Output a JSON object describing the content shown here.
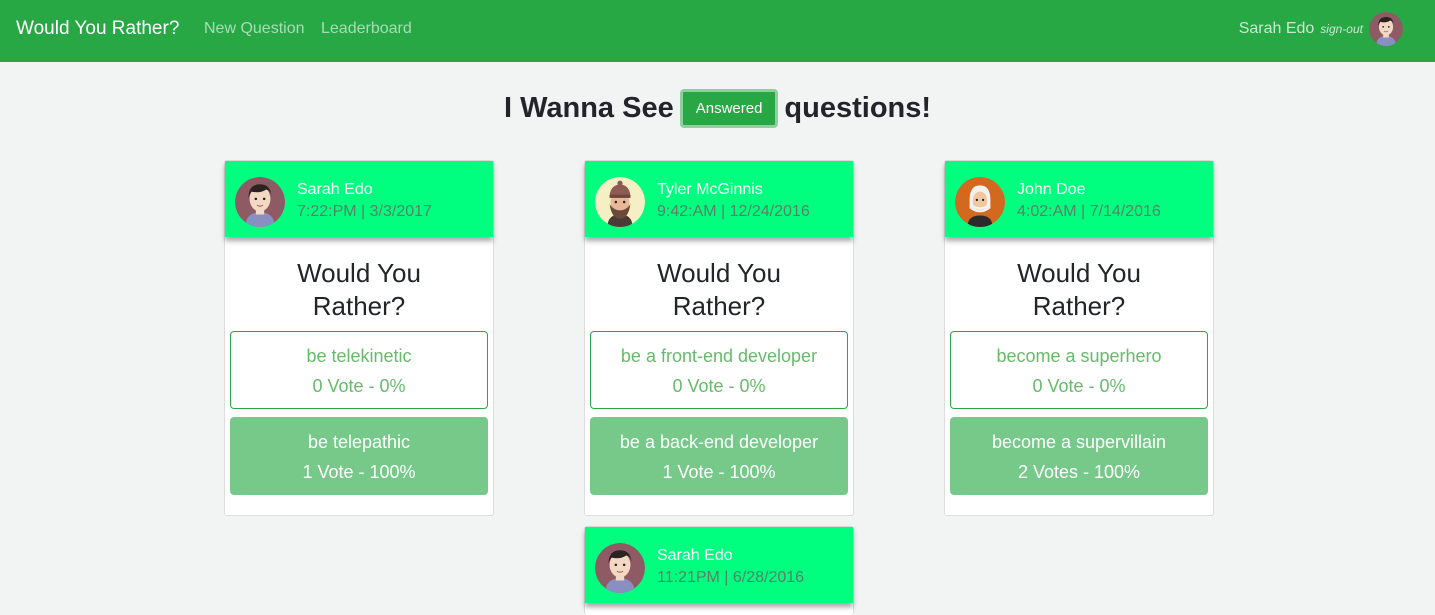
{
  "nav": {
    "brand": "Would You Rather?",
    "links": [
      "New Question",
      "Leaderboard"
    ],
    "user_name": "Sarah Edo",
    "signout": "sign-out"
  },
  "heading": {
    "prefix": "I Wanna See",
    "filter_button": "Answered",
    "suffix": "questions!"
  },
  "colors": {
    "navbar": "#28a745",
    "card_header": "#00ff7f",
    "option_selected": "#77c98a",
    "option_text": "#66bb6a"
  },
  "questions": [
    {
      "author": "Sarah Edo",
      "avatar": "sarah-avatar-icon",
      "time": "7:22:PM | 3/3/2017",
      "title": "Would You Rather?",
      "optionOne": {
        "text": "be telekinetic",
        "votes": "0 Vote - 0%"
      },
      "optionTwo": {
        "text": "be telepathic",
        "votes": "1 Vote - 100%"
      }
    },
    {
      "author": "Tyler McGinnis",
      "avatar": "tyler-avatar-icon",
      "time": "9:42:AM | 12/24/2016",
      "title": "Would You Rather?",
      "optionOne": {
        "text": "be a front-end developer",
        "votes": "0 Vote - 0%"
      },
      "optionTwo": {
        "text": "be a back-end developer",
        "votes": "1 Vote - 100%"
      }
    },
    {
      "author": "John Doe",
      "avatar": "john-avatar-icon",
      "time": "4:02:AM | 7/14/2016",
      "title": "Would You Rather?",
      "optionOne": {
        "text": "become a superhero",
        "votes": "0 Vote - 0%"
      },
      "optionTwo": {
        "text": "become a supervillain",
        "votes": "2 Votes - 100%"
      }
    },
    {
      "author": "Sarah Edo",
      "avatar": "sarah-avatar-icon",
      "time": "11:21PM | 6/28/2016"
    }
  ]
}
